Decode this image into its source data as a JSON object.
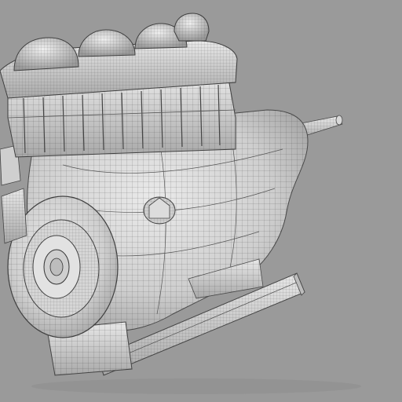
{
  "scene": {
    "subject": "wireframe-engine-model",
    "colors": {
      "background": "#9a9a9a",
      "surface_light": "#e4e4e4",
      "surface_mid": "#c9c9c9",
      "surface_dark": "#8e8e8e",
      "wire": "#3a3a3a"
    }
  }
}
